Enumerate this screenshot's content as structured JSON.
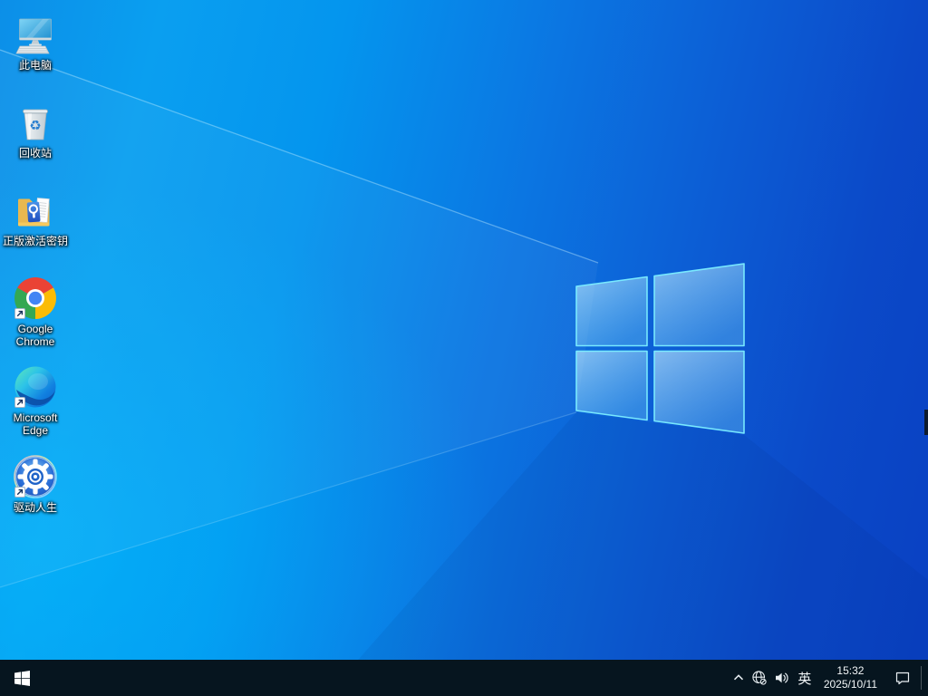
{
  "desktop": {
    "icons": [
      {
        "id": "this-pc",
        "label": "此电脑",
        "icon": "computer-monitor-icon",
        "has_shortcut_arrow": false
      },
      {
        "id": "recycle-bin",
        "label": "回收站",
        "icon": "recycle-bin-icon",
        "has_shortcut_arrow": false
      },
      {
        "id": "activation-keys",
        "label": "正版激活密钥",
        "icon": "yellow-folder-icon",
        "has_shortcut_arrow": false
      },
      {
        "id": "google-chrome",
        "label": "Google Chrome",
        "icon": "chrome-icon",
        "has_shortcut_arrow": true
      },
      {
        "id": "microsoft-edge",
        "label": "Microsoft Edge",
        "icon": "edge-icon",
        "has_shortcut_arrow": true
      },
      {
        "id": "driver-life",
        "label": "驱动人生",
        "icon": "blue-gear-ring-icon",
        "has_shortcut_arrow": true
      }
    ]
  },
  "taskbar": {
    "tray": {
      "ime_label": "英",
      "time": "15:32",
      "date": "2025/10/11",
      "icons": [
        "hidden-icons-chevron",
        "network-globe-offline",
        "volume",
        "ime-indicator",
        "clock",
        "action-center"
      ]
    }
  },
  "colors": {
    "wallpaper_bright_left": "#00a7f2",
    "wallpaper_deep_right": "#0941c3",
    "logo_edge_cyan": "#7ceeff",
    "taskbar_background": "#06151f",
    "label_text": "#ffffff"
  }
}
